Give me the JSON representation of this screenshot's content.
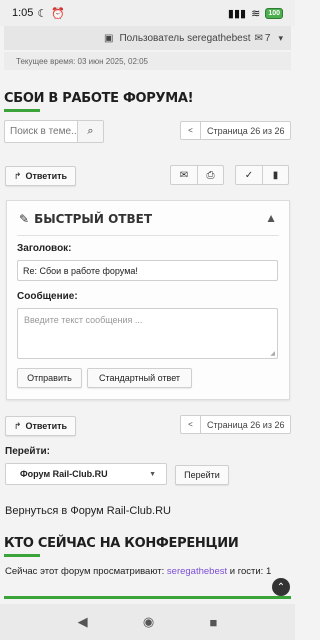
{
  "status_bar": {
    "time": "1:05",
    "battery": "100"
  },
  "topbar": {
    "user_label": "Пользователь seregathebest",
    "notif_count": "7"
  },
  "time_line": "Текущее время: 03 июн 2025, 02:05",
  "page_title": "СБОИ В РАБОТЕ ФОРУМА!",
  "search": {
    "placeholder": "Поиск в теме..."
  },
  "pagination": {
    "prev": "<",
    "label": "Страница 26 из 26"
  },
  "reply_button": "Ответить",
  "quick_reply": {
    "title": "БЫСТРЫЙ ОТВЕТ",
    "subject_label": "Заголовок:",
    "subject_value": "Re: Сбои в работе форума!",
    "message_label": "Сообщение:",
    "message_placeholder": "Введите текст сообщения ...",
    "send_button": "Отправить",
    "full_editor_button": "Стандартный ответ"
  },
  "goto": {
    "label": "Перейти:",
    "selected": "Форум Rail-Club.RU",
    "button": "Перейти"
  },
  "back_link": "Вернуться в Форум Rail-Club.RU",
  "online": {
    "title": "КТО СЕЙЧАС НА КОНФЕРЕНЦИИ",
    "prefix": "Сейчас этот форум просматривают:",
    "user": "seregathebest",
    "suffix": "и гости: 1"
  },
  "colors": {
    "accent": "#3aa33a",
    "link": "#7b4fd6"
  }
}
